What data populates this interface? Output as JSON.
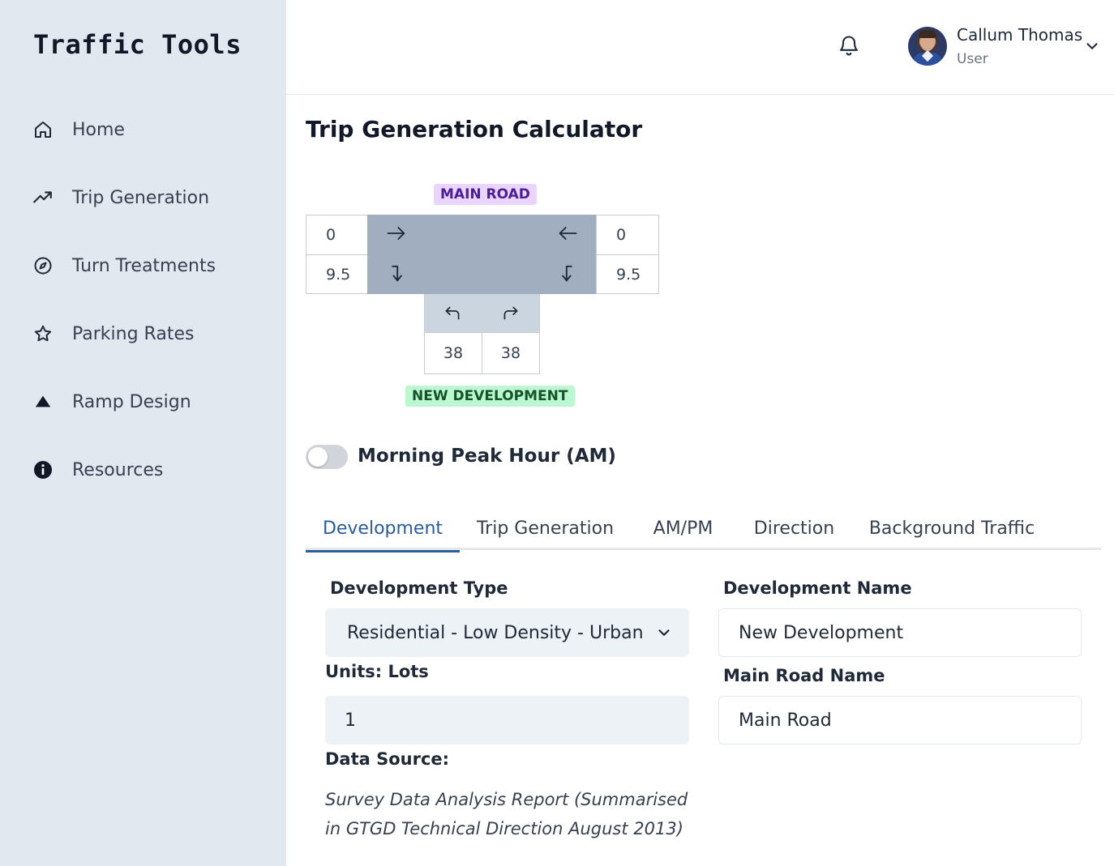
{
  "brand": "Traffic Tools",
  "sidebar": {
    "items": [
      {
        "label": "Home",
        "icon": "home-icon"
      },
      {
        "label": "Trip Generation",
        "icon": "trending-up-icon"
      },
      {
        "label": "Turn Treatments",
        "icon": "compass-icon"
      },
      {
        "label": "Parking Rates",
        "icon": "star-icon"
      },
      {
        "label": "Ramp Design",
        "icon": "triangle-up-icon"
      },
      {
        "label": "Resources",
        "icon": "info-icon"
      }
    ]
  },
  "header": {
    "user_name": "Callum Thomas",
    "user_role": "User"
  },
  "page": {
    "title": "Trip Generation Calculator"
  },
  "diagram": {
    "main_road_label": "MAIN ROAD",
    "development_label": "NEW DEVELOPMENT",
    "left_top": "0",
    "left_bottom": "9.5",
    "right_top": "0",
    "right_bottom": "9.5",
    "stem_left": "38",
    "stem_right": "38"
  },
  "peak": {
    "label": "Morning Peak Hour (AM)",
    "enabled": false
  },
  "tabs": [
    {
      "label": "Development",
      "active": true
    },
    {
      "label": "Trip Generation",
      "active": false
    },
    {
      "label": "AM/PM",
      "active": false
    },
    {
      "label": "Direction",
      "active": false
    },
    {
      "label": "Background Traffic",
      "active": false
    }
  ],
  "form": {
    "development_type_label": "Development Type",
    "development_type_value": "Residential - Low Density - Urban (Sydney)",
    "units_label": "Units: Lots",
    "units_value": "1",
    "data_source_label": "Data Source:",
    "data_source_value": "Survey Data Analysis Report (Summarised in GTGD Technical Direction August 2013)",
    "development_name_label": "Development Name",
    "development_name_value": "New Development",
    "main_road_name_label": "Main Road Name",
    "main_road_name_value": "Main Road"
  }
}
